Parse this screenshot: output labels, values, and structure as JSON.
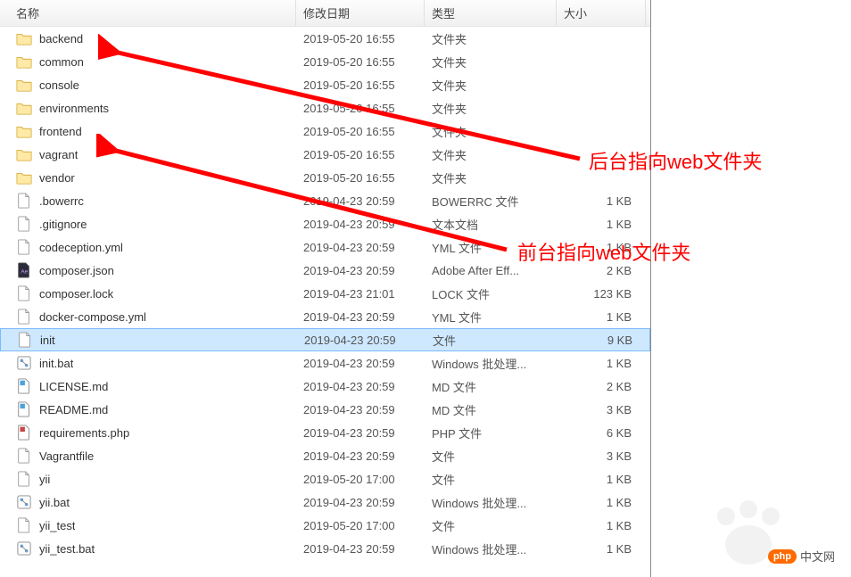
{
  "columns": {
    "name": "名称",
    "date": "修改日期",
    "type": "类型",
    "size": "大小"
  },
  "selected_index": 13,
  "files": [
    {
      "icon": "folder",
      "name": "backend",
      "date": "2019-05-20 16:55",
      "type": "文件夹",
      "size": ""
    },
    {
      "icon": "folder",
      "name": "common",
      "date": "2019-05-20 16:55",
      "type": "文件夹",
      "size": ""
    },
    {
      "icon": "folder",
      "name": "console",
      "date": "2019-05-20 16:55",
      "type": "文件夹",
      "size": ""
    },
    {
      "icon": "folder",
      "name": "environments",
      "date": "2019-05-20 16:55",
      "type": "文件夹",
      "size": ""
    },
    {
      "icon": "folder",
      "name": "frontend",
      "date": "2019-05-20 16:55",
      "type": "文件夹",
      "size": ""
    },
    {
      "icon": "folder",
      "name": "vagrant",
      "date": "2019-05-20 16:55",
      "type": "文件夹",
      "size": ""
    },
    {
      "icon": "folder",
      "name": "vendor",
      "date": "2019-05-20 16:55",
      "type": "文件夹",
      "size": ""
    },
    {
      "icon": "file",
      "name": ".bowerrc",
      "date": "2019-04-23 20:59",
      "type": "BOWERRC 文件",
      "size": "1 KB"
    },
    {
      "icon": "file",
      "name": ".gitignore",
      "date": "2019-04-23 20:59",
      "type": "文本文档",
      "size": "1 KB"
    },
    {
      "icon": "file",
      "name": "codeception.yml",
      "date": "2019-04-23 20:59",
      "type": "YML 文件",
      "size": "1 KB"
    },
    {
      "icon": "json",
      "name": "composer.json",
      "date": "2019-04-23 20:59",
      "type": "Adobe After Eff...",
      "size": "2 KB"
    },
    {
      "icon": "file",
      "name": "composer.lock",
      "date": "2019-04-23 21:01",
      "type": "LOCK 文件",
      "size": "123 KB"
    },
    {
      "icon": "file",
      "name": "docker-compose.yml",
      "date": "2019-04-23 20:59",
      "type": "YML 文件",
      "size": "1 KB"
    },
    {
      "icon": "file",
      "name": "init",
      "date": "2019-04-23 20:59",
      "type": "文件",
      "size": "9 KB"
    },
    {
      "icon": "bat",
      "name": "init.bat",
      "date": "2019-04-23 20:59",
      "type": "Windows 批处理...",
      "size": "1 KB"
    },
    {
      "icon": "md",
      "name": "LICENSE.md",
      "date": "2019-04-23 20:59",
      "type": "MD 文件",
      "size": "2 KB"
    },
    {
      "icon": "md",
      "name": "README.md",
      "date": "2019-04-23 20:59",
      "type": "MD 文件",
      "size": "3 KB"
    },
    {
      "icon": "php",
      "name": "requirements.php",
      "date": "2019-04-23 20:59",
      "type": "PHP 文件",
      "size": "6 KB"
    },
    {
      "icon": "file",
      "name": "Vagrantfile",
      "date": "2019-04-23 20:59",
      "type": "文件",
      "size": "3 KB"
    },
    {
      "icon": "file",
      "name": "yii",
      "date": "2019-05-20 17:00",
      "type": "文件",
      "size": "1 KB"
    },
    {
      "icon": "bat",
      "name": "yii.bat",
      "date": "2019-04-23 20:59",
      "type": "Windows 批处理...",
      "size": "1 KB"
    },
    {
      "icon": "file",
      "name": "yii_test",
      "date": "2019-05-20 17:00",
      "type": "文件",
      "size": "1 KB"
    },
    {
      "icon": "bat",
      "name": "yii_test.bat",
      "date": "2019-04-23 20:59",
      "type": "Windows 批处理...",
      "size": "1 KB"
    }
  ],
  "annotations": {
    "backend_label": "后台指向web文件夹",
    "frontend_label": "前台指向web文件夹"
  },
  "watermark": {
    "php_badge": "php",
    "site": "中文网"
  }
}
